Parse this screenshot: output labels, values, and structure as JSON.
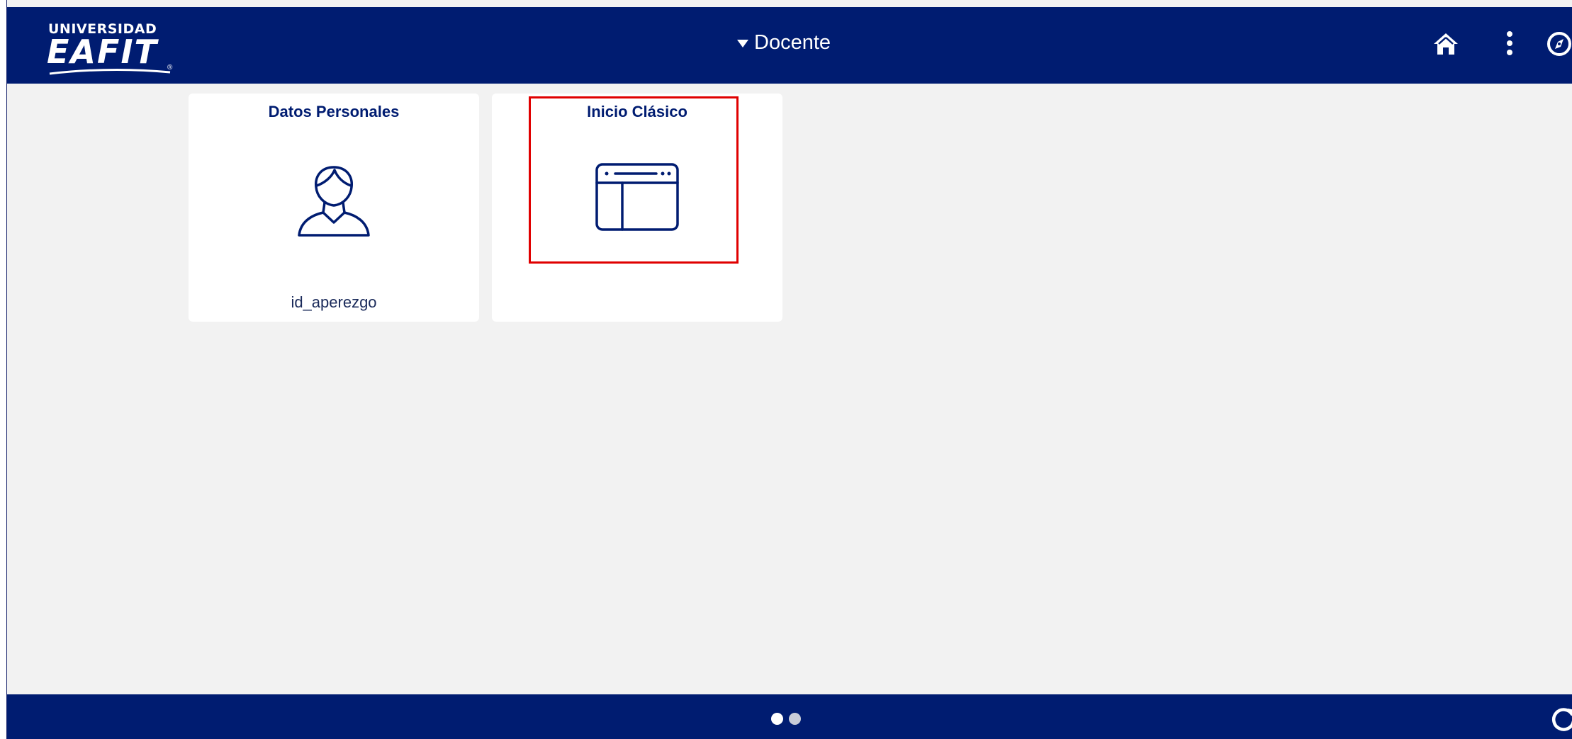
{
  "header": {
    "logo": {
      "top_text": "UNIVERSIDAD",
      "main_text": "EAFIT",
      "reg_mark": "®"
    },
    "homepage_selector": "Docente",
    "icons": [
      "home-icon",
      "actions-menu-icon",
      "navbar-icon"
    ]
  },
  "tiles": [
    {
      "title": "Datos Personales",
      "subtitle": "id_aperezgo",
      "icon": "person-icon"
    },
    {
      "title": "Inicio Clásico",
      "subtitle": "",
      "icon": "classic-window-icon",
      "highlighted": true
    }
  ],
  "footer": {
    "page_dots": {
      "count": 2,
      "active_index": 0
    },
    "icon": "refresh-icon"
  },
  "colors": {
    "brand_navy": "#001c71",
    "background": "#f2f2f2",
    "highlight": "#e00000"
  }
}
